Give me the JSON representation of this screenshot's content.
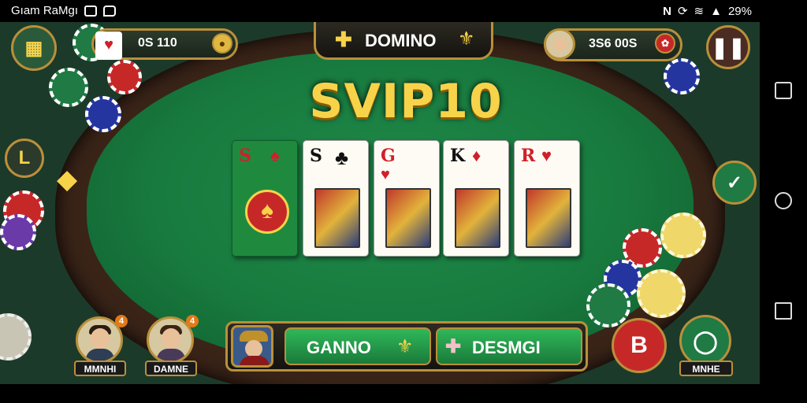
{
  "status_bar": {
    "app_name": "Gıam RaMgı",
    "battery": "29%"
  },
  "top_bar": {
    "left_balance": "0S 110",
    "title": "DOMINO",
    "right_balance": "3S6 00S",
    "title_left_icon": "plus-icon",
    "title_right_icon": "fleur-icon"
  },
  "banner": {
    "text": "SVIP10"
  },
  "left_button_label": "L",
  "cards": [
    {
      "rank": "S",
      "suit_glyph": "♠",
      "suit_color": "#d0202a",
      "green": true
    },
    {
      "rank": "S",
      "suit_glyph": "♣",
      "suit_color": "#111111",
      "green": false
    },
    {
      "rank": "G",
      "suit_glyph": "♥",
      "suit_color": "#d0202a",
      "green": false
    },
    {
      "rank": "K",
      "suit_glyph": "♦",
      "suit_color": "#111111",
      "green": false
    },
    {
      "rank": "R",
      "suit_glyph": "♥",
      "suit_color": "#d0202a",
      "green": false
    }
  ],
  "players": [
    {
      "name": "MMNHI",
      "badge": "4"
    },
    {
      "name": "DAMNE",
      "badge": "4"
    }
  ],
  "action_bar": {
    "left_label": "GANNO",
    "right_label": "DESMGI"
  },
  "bottom_right": {
    "red_button_label": "B",
    "right_button_name": "MNHE"
  },
  "colors": {
    "felt": "#187a3e",
    "gold": "#f7d34a",
    "accent_green": "#1fa04a",
    "red": "#c62828"
  }
}
